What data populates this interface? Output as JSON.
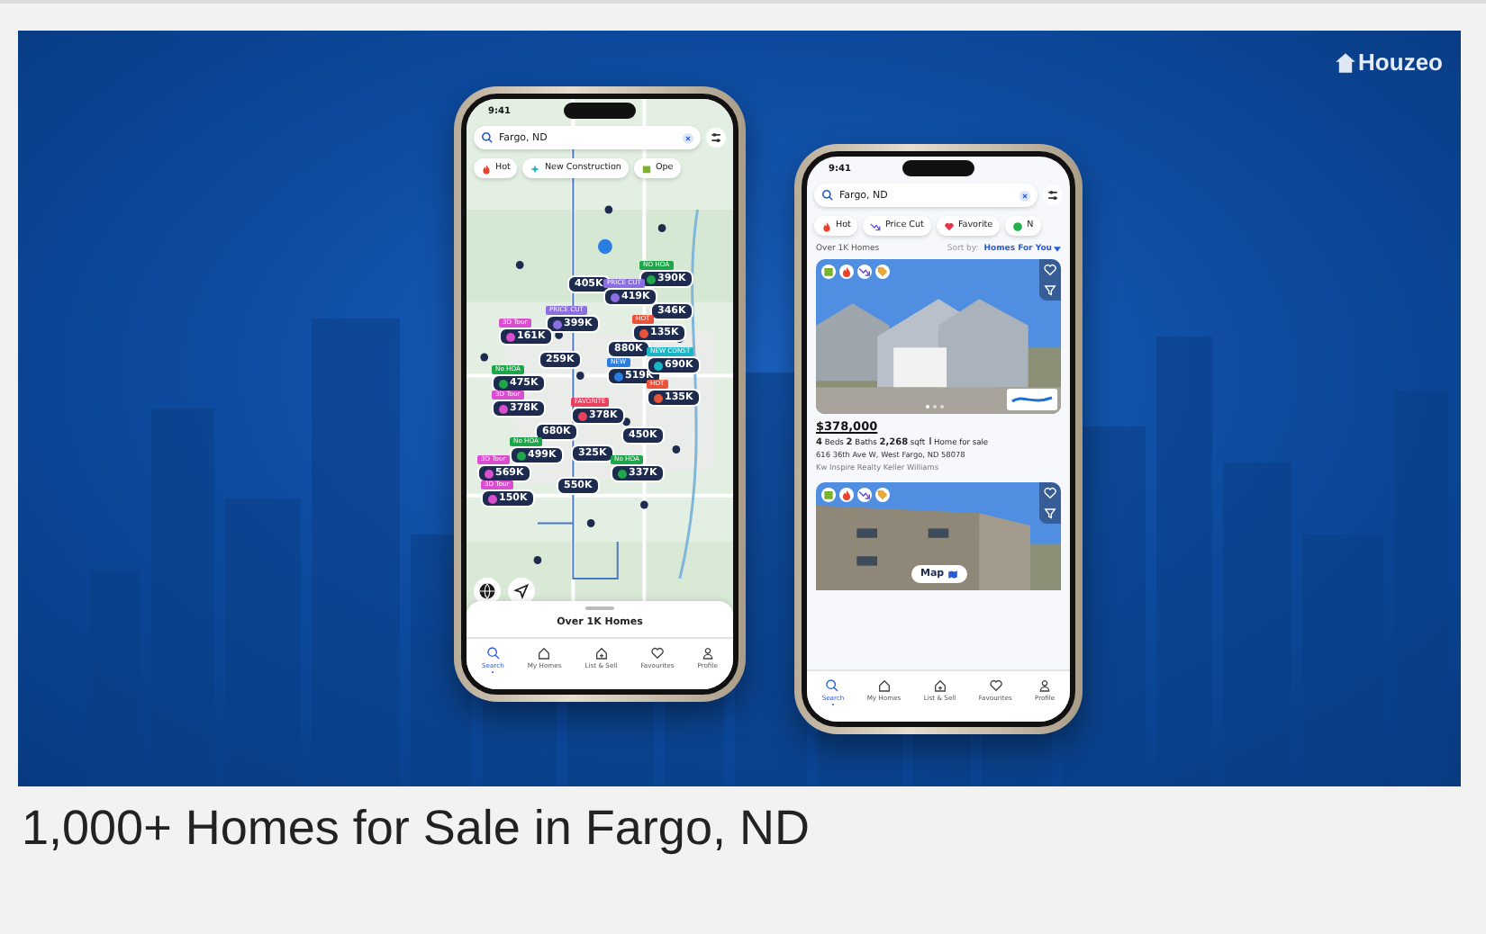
{
  "banner": {
    "logo": "Houzeo"
  },
  "map_phone": {
    "time": "9:41",
    "search": "Fargo, ND",
    "chips": [
      {
        "label": "Hot",
        "kind": "hot"
      },
      {
        "label": "New Construction",
        "kind": "new"
      },
      {
        "label": "Ope",
        "kind": "open"
      }
    ],
    "pins": [
      {
        "price": "390K",
        "tag": "NO HOA",
        "color": "#1fa64a"
      },
      {
        "price": "405K"
      },
      {
        "price": "419K",
        "tag": "PRICE CUT",
        "color": "#8b6ee0"
      },
      {
        "price": "346K"
      },
      {
        "price": "399K",
        "tag": "PRICE CUT",
        "color": "#8b6ee0"
      },
      {
        "price": "161K",
        "tag": "3D Tour",
        "color": "#d94fd0"
      },
      {
        "price": "135K",
        "tag": "HOT",
        "color": "#e8533a"
      },
      {
        "price": "880K"
      },
      {
        "price": "259K"
      },
      {
        "price": "519K",
        "tag": "NEW",
        "color": "#2a7de1"
      },
      {
        "price": "690K",
        "tag": "NEW CONST",
        "color": "#19b5c4"
      },
      {
        "price": "475K",
        "tag": "No HOA",
        "color": "#1fa64a"
      },
      {
        "price": "378K",
        "tag": "3D Tour",
        "color": "#d94fd0"
      },
      {
        "price": "378K",
        "tag": "FAVORITE",
        "color": "#e8405e"
      },
      {
        "price": "135K",
        "tag": "HOT",
        "color": "#e8533a"
      },
      {
        "price": "680K"
      },
      {
        "price": "450K"
      },
      {
        "price": "499K",
        "tag": "No HOA",
        "color": "#1fa64a"
      },
      {
        "price": "325K"
      },
      {
        "price": "569K",
        "tag": "3D Tour",
        "color": "#d94fd0"
      },
      {
        "price": "337K",
        "tag": "No HOA",
        "color": "#1fa64a"
      },
      {
        "price": "150K",
        "tag": "3D Tour",
        "color": "#d94fd0"
      },
      {
        "price": "550K"
      }
    ],
    "sheet_title": "Over 1K Homes",
    "nav": [
      {
        "label": "Search",
        "kind": "search",
        "selected": true
      },
      {
        "label": "My Homes",
        "kind": "home",
        "selected": false
      },
      {
        "label": "List & Sell",
        "kind": "sell",
        "selected": false
      },
      {
        "label": "Favourites",
        "kind": "heart",
        "selected": false
      },
      {
        "label": "Profile",
        "kind": "profile",
        "selected": false
      }
    ]
  },
  "list_phone": {
    "time": "9:41",
    "search": "Fargo, ND",
    "chips": [
      {
        "label": "Hot",
        "kind": "hot"
      },
      {
        "label": "Price Cut",
        "kind": "pricecut"
      },
      {
        "label": "Favorite",
        "kind": "favorite"
      },
      {
        "label": "N",
        "kind": "nohoa"
      }
    ],
    "count": "Over 1K Homes",
    "sort_label": "Sort by:",
    "sort_value": "Homes For You",
    "listings": [
      {
        "kind": "house",
        "price": "$378,000",
        "beds": "4",
        "beds_label": "Beds",
        "baths": "2",
        "baths_label": "Baths",
        "sqft": "2,268",
        "sqft_label": "sqft",
        "status": "Home for sale",
        "address": "616 36th Ave W, West Fargo, ND 58078",
        "agent": "Kw Inspire Realty Keller Williams"
      },
      {
        "kind": "apartment",
        "map_button": "Map"
      }
    ],
    "nav": [
      {
        "label": "Search",
        "kind": "search",
        "selected": true
      },
      {
        "label": "My Homes",
        "kind": "home",
        "selected": false
      },
      {
        "label": "List & Sell",
        "kind": "sell",
        "selected": false
      },
      {
        "label": "Favourites",
        "kind": "heart",
        "selected": false
      },
      {
        "label": "Profile",
        "kind": "profile",
        "selected": false
      }
    ]
  },
  "caption": "1,000+ Homes for Sale in Fargo, ND"
}
